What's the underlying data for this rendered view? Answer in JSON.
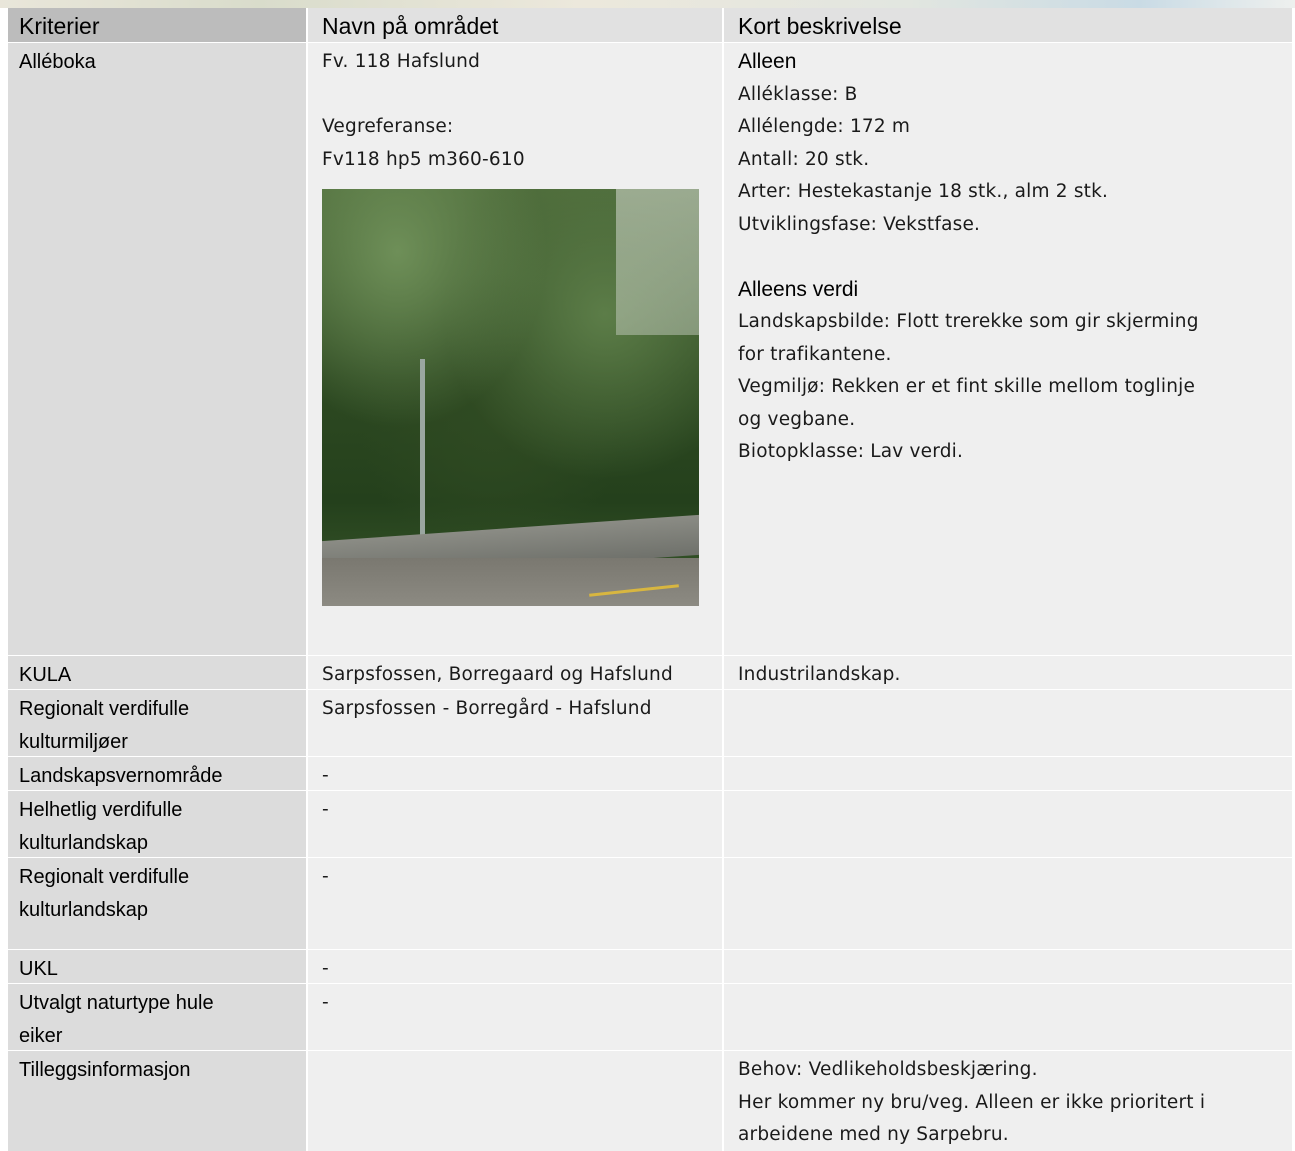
{
  "header": {
    "col1": "Kriterier",
    "col2": "Navn på området",
    "col3": "Kort beskrivelse"
  },
  "alleboka": {
    "label": "Alléboka",
    "name": "Fv. 118 Hafslund",
    "vegref_label": "Vegreferanse:",
    "vegref_value": "Fv118 hp5 m360-610",
    "alleen_heading": "Alleen",
    "alleen_lines": [
      "Alléklasse: B",
      "Allélengde: 172 m",
      "Antall: 20 stk.",
      "Arter: Hestekastanje 18 stk., alm 2 stk.",
      "Utviklingsfase: Vekstfase."
    ],
    "verdi_heading": "Alleens verdi",
    "verdi_lines": [
      "Landskapsbilde: Flott trerekke som gir skjerming",
      "for trafikantene.",
      "Vegmiljø: Rekken er et fint skille mellom toglinje",
      "og vegbane.",
      "Biotopklasse: Lav verdi."
    ]
  },
  "rows": [
    {
      "label_lines": [
        "KULA"
      ],
      "name": "Sarpsfossen, Borregaard og Hafslund",
      "desc_lines": [
        "Industrilandskap."
      ]
    },
    {
      "label_lines": [
        "Regionalt verdifulle",
        "kulturmiljøer"
      ],
      "name": "Sarpsfossen - Borregård - Hafslund",
      "desc_lines": []
    },
    {
      "label_lines": [
        "Landskapsvernområde"
      ],
      "name": "-",
      "desc_lines": []
    },
    {
      "label_lines": [
        "Helhetlig verdifulle",
        "kulturlandskap"
      ],
      "name": "-",
      "desc_lines": []
    },
    {
      "label_lines": [
        "Regionalt verdifulle",
        "kulturlandskap"
      ],
      "name": "-",
      "desc_lines": []
    },
    {
      "label_lines": [
        "UKL"
      ],
      "name": "-",
      "desc_lines": []
    },
    {
      "label_lines": [
        "Utvalgt naturtype hule",
        "eiker"
      ],
      "name": "-",
      "desc_lines": []
    },
    {
      "label_lines": [
        "Tilleggsinformasjon"
      ],
      "name": "",
      "desc_lines": [
        "Behov: Vedlikeholdsbeskjæring.",
        "Her kommer ny bru/veg. Alleen er ikke prioritert i",
        "arbeidene med ny Sarpebru."
      ]
    }
  ]
}
